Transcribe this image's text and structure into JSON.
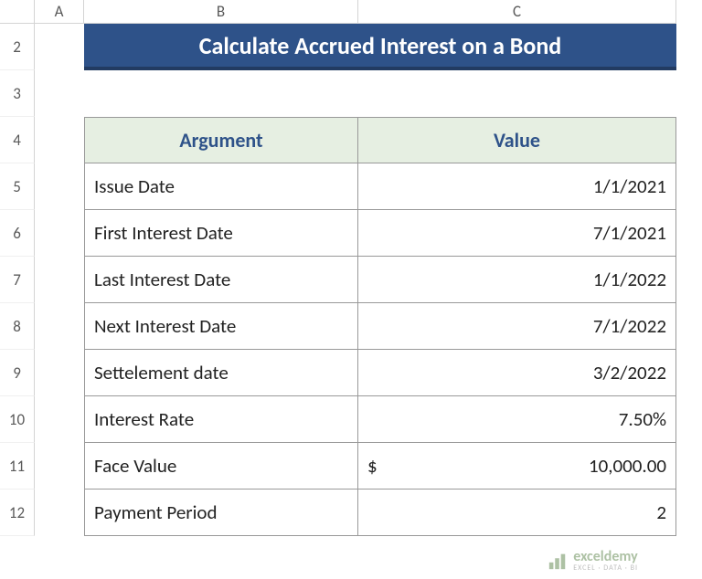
{
  "columns": [
    "A",
    "B",
    "C"
  ],
  "rows": [
    "2",
    "3",
    "4",
    "5",
    "6",
    "7",
    "8",
    "9",
    "10",
    "11",
    "12"
  ],
  "title": "Calculate Accrued Interest on a Bond",
  "headers": {
    "argument": "Argument",
    "value": "Value"
  },
  "table": [
    {
      "arg": "Issue Date",
      "val": "1/1/2021"
    },
    {
      "arg": "First Interest Date",
      "val": "7/1/2021"
    },
    {
      "arg": "Last Interest Date",
      "val": "1/1/2022"
    },
    {
      "arg": "Next Interest Date",
      "val": "7/1/2022"
    },
    {
      "arg": "Settelement date",
      "val": "3/2/2022"
    },
    {
      "arg": "Interest Rate",
      "val": "7.50%"
    },
    {
      "arg": "Face Value",
      "val": "10,000.00",
      "currency": "$"
    },
    {
      "arg": "Payment Period",
      "val": "2"
    }
  ],
  "watermark": {
    "name": "exceldemy",
    "tag": "EXCEL · DATA · BI"
  }
}
